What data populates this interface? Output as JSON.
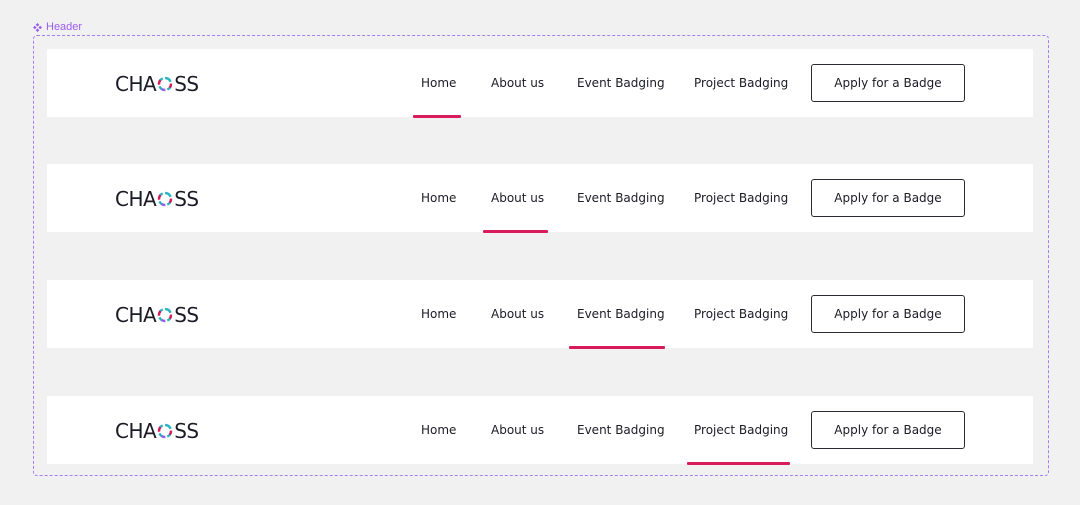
{
  "component": {
    "label": "Header"
  },
  "logo": {
    "text_left": "CHA",
    "text_right": "SS"
  },
  "nav": {
    "home": "Home",
    "about": "About us",
    "event": "Event Badging",
    "project": "Project Badging"
  },
  "cta": {
    "label": "Apply for a Badge"
  },
  "colors": {
    "accent": "#d81b5a",
    "frame": "#a77df2",
    "logo_ring": [
      "#d81b5a",
      "#2bb3c0",
      "#9b5cf0",
      "#f29ac0"
    ]
  },
  "variants": [
    {
      "active": "home"
    },
    {
      "active": "about"
    },
    {
      "active": "event"
    },
    {
      "active": "project"
    }
  ]
}
